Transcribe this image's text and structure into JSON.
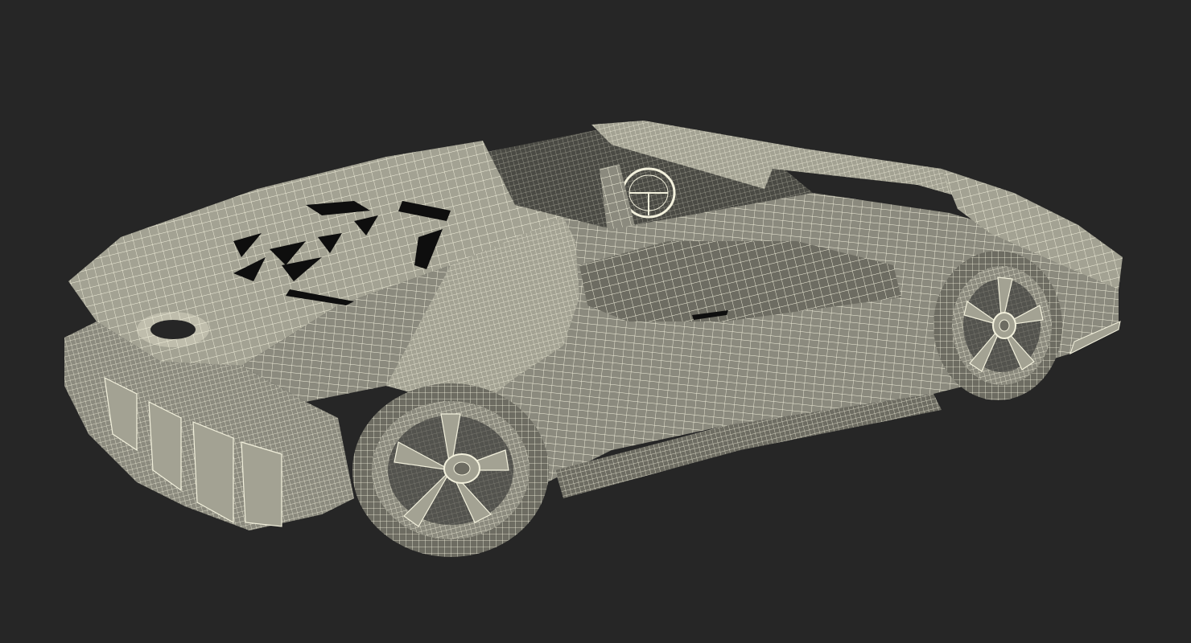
{
  "scene": {
    "subject": "car-wireframe-render",
    "colors": {
      "background": "#262626",
      "surface": "#8b8a7e",
      "surface_light": "#a3a293",
      "surface_dark": "#6d6c62",
      "wire": "#f3f1dd",
      "opening": "#0e0e0e",
      "interior": "#4a4a44"
    }
  }
}
